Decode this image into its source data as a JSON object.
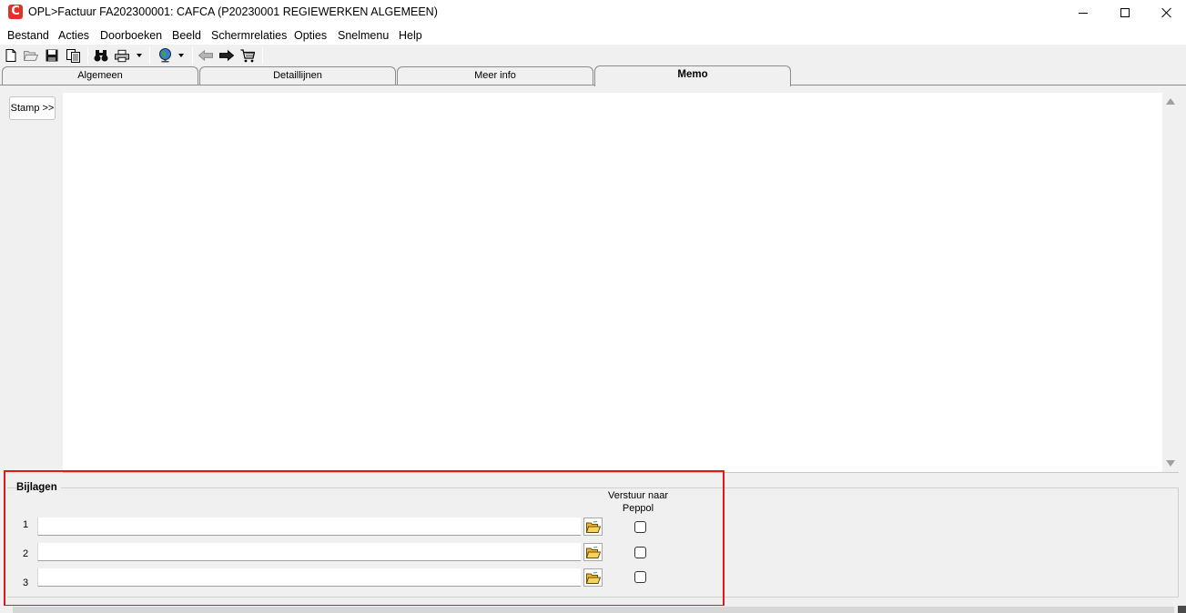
{
  "window": {
    "title": "OPL>Factuur FA202300001: CAFCA (P20230001 REGIEWERKEN ALGEMEEN)",
    "logo_letter": "C",
    "controls": [
      "minimize-icon",
      "maximize-icon",
      "close-icon"
    ]
  },
  "menu": {
    "items": [
      "Bestand",
      "Acties",
      "Doorboeken",
      "Beeld",
      "Schermrelaties",
      "Opties",
      "Snelmenu",
      "Help"
    ]
  },
  "toolbar": {
    "icons": [
      "new-document-icon",
      "open-folder-icon",
      "save-icon",
      "copy-icon",
      "binoculars-icon",
      "printer-icon",
      "globe-icon",
      "back-arrow-icon",
      "forward-arrow-icon",
      "cart-icon"
    ]
  },
  "tabs": {
    "items": [
      {
        "label": "Algemeen",
        "active": false
      },
      {
        "label": "Detaillijnen",
        "active": false
      },
      {
        "label": "Meer info",
        "active": false
      },
      {
        "label": "Memo",
        "active": true
      }
    ]
  },
  "memo": {
    "stamp_button": "Stamp >>",
    "content": ""
  },
  "attachments": {
    "title": "Bijlagen",
    "peppol_header": "Verstuur naar Peppol",
    "rows": [
      {
        "number": "1",
        "value": "",
        "peppol": false
      },
      {
        "number": "2",
        "value": "",
        "peppol": false
      },
      {
        "number": "3",
        "value": "",
        "peppol": false
      }
    ]
  },
  "colors": {
    "logo": "#e0312b",
    "highlight": "#e0191a",
    "background": "#f0f0f0"
  }
}
